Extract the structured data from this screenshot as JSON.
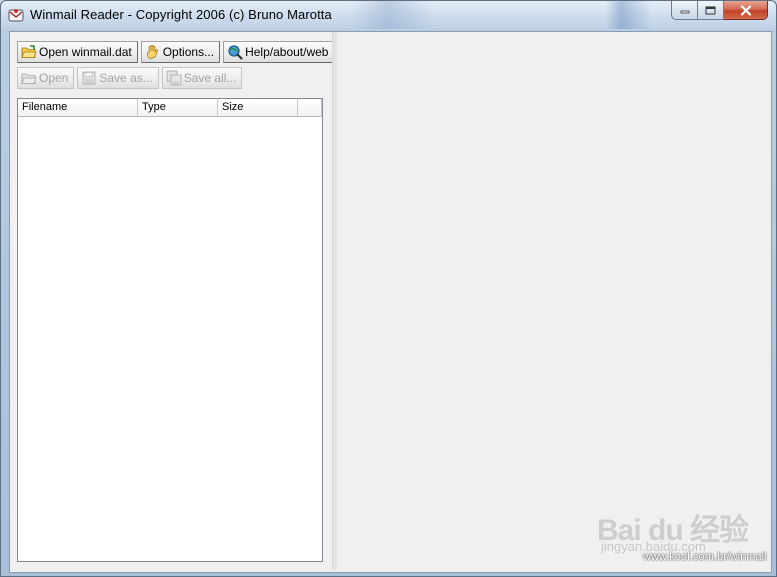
{
  "window": {
    "title": "Winmail Reader - Copyright 2006 (c) Bruno Marotta"
  },
  "toolbar": {
    "open_winmail_label": "Open winmail.dat",
    "options_label": "Options...",
    "help_label": "Help/about/web",
    "open_label": "Open",
    "save_as_label": "Save as...",
    "save_all_label": "Save all..."
  },
  "filelist": {
    "columns": [
      "Filename",
      "Type",
      "Size",
      ""
    ]
  },
  "watermark": {
    "brand": "Bai du 经验",
    "sub": "jingyan.baidu.com",
    "url": "www.koof.com.br/winmail"
  },
  "icons": {
    "app": "mail-envelope-icon",
    "open_winmail": "folder-open-icon",
    "options": "hand-icon",
    "help": "magnifier-globe-icon",
    "open": "folder-open-icon",
    "save_as": "floppy-disk-icon",
    "save_all": "floppy-disks-icon"
  }
}
